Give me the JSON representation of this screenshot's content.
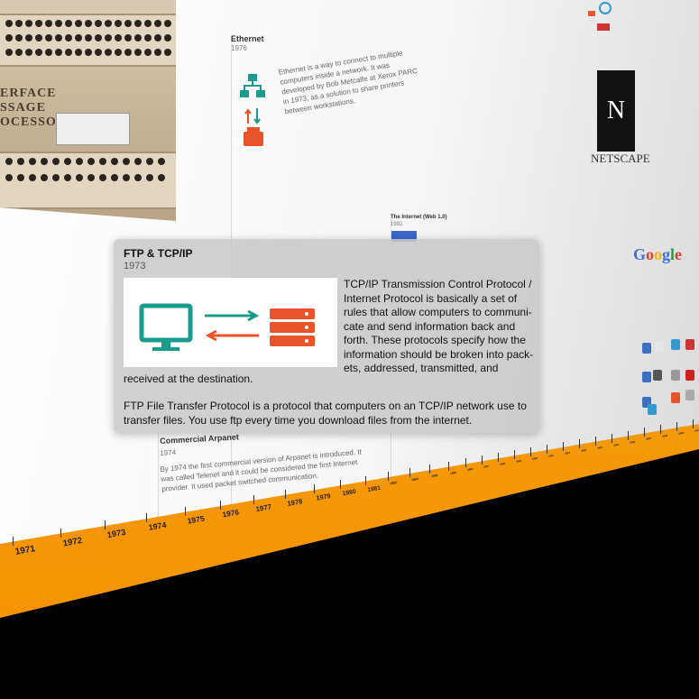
{
  "popup": {
    "title": "FTP & TCP/IP",
    "year": "1973",
    "paragraph1": "TCP/IP Transmission Control Protocol / Internet Protocol is basically a set of rules that allow computers to communi-cate and send information back and forth. These protocols specify how the information should be broken into pack-ets, addressed, transmitted, and",
    "paragraph1_tail": "received at the destination.",
    "paragraph2": "FTP File Transfer Protocol is a protocol that computers on an TCP/IP network use to transfer files. You use ftp every time you download files from the internet.",
    "image_colors": {
      "monitor": "#1a9b8c",
      "arrow_right": "#1a9b8c",
      "arrow_left": "#e8542a",
      "server": "#e8542a"
    }
  },
  "timeline": {
    "years": [
      "1971",
      "1972",
      "1973",
      "1974",
      "1975",
      "1976",
      "1977",
      "1978",
      "1979",
      "1980",
      "1981",
      "1982",
      "1983",
      "1984",
      "1985",
      "1986",
      "1987",
      "1988",
      "1989",
      "1990",
      "1991",
      "1992",
      "1993",
      "1994",
      "1995",
      "1996",
      "1997",
      "1998",
      "1999",
      "2000"
    ],
    "accent_color": "#f39200"
  },
  "events": {
    "ethernet": {
      "title": "Ethernet",
      "year": "1976",
      "text": "Ethernet is a way to connect to multiple computers inside a network. It was developed by Bob Metcalfe at Xerox PARC in 1973, as a solution to share printers between workstations."
    },
    "commercial_arpanet": {
      "title": "Commercial Arpanet",
      "year": "1974",
      "text": "By 1974 the first commercial version of Arpanet is introduced. It was called Telenet and it could be considered the first Internet provider. It used packet switched communication."
    },
    "web1": {
      "title": "The Internet (Web 1.0)",
      "year": "1992"
    },
    "netscape": {
      "logo_letter": "N",
      "word": "NETSCAPE"
    },
    "google": {
      "word": "Google"
    }
  },
  "machine": {
    "label_lines": [
      "ERFACE",
      "SSAGE",
      "OCESSOR"
    ]
  }
}
